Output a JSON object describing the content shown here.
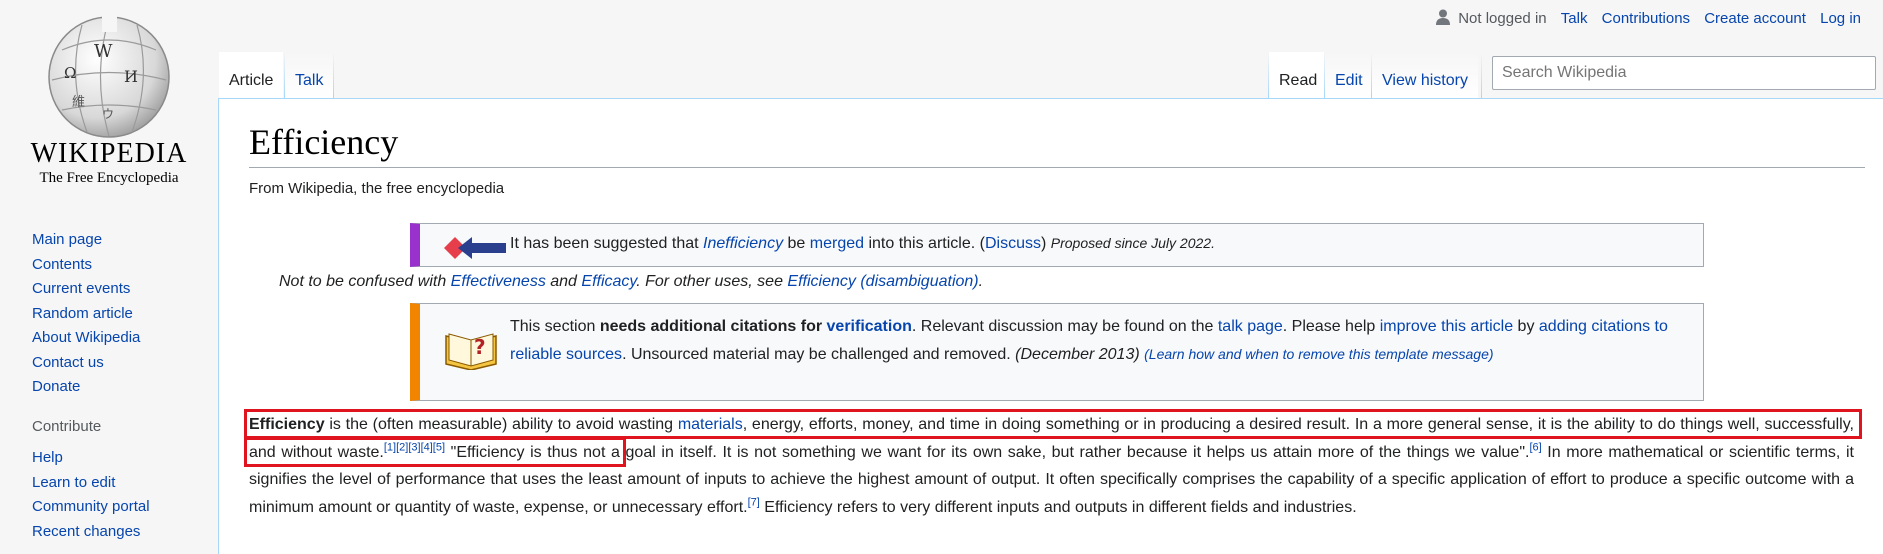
{
  "logo": {
    "wordmark": "WIKIPEDIA",
    "tagline": "The Free Encyclopedia"
  },
  "sidebar": {
    "nav": [
      "Main page",
      "Contents",
      "Current events",
      "Random article",
      "About Wikipedia",
      "Contact us",
      "Donate"
    ],
    "contribute_heading": "Contribute",
    "contribute": [
      "Help",
      "Learn to edit",
      "Community portal",
      "Recent changes"
    ]
  },
  "personal": {
    "status": "Not logged in",
    "talk": "Talk",
    "contributions": "Contributions",
    "create_account": "Create account",
    "login": "Log in"
  },
  "tabs": {
    "article": "Article",
    "talk": "Talk",
    "read": "Read",
    "edit": "Edit",
    "history": "View history"
  },
  "search": {
    "placeholder": "Search Wikipedia"
  },
  "page": {
    "title": "Efficiency",
    "tagline": "From Wikipedia, the free encyclopedia",
    "merge": {
      "pre": "It has been suggested that ",
      "target": "Inefficiency",
      "mid": " be ",
      "merged": "merged",
      "post": " into this article. (",
      "discuss": "Discuss",
      "close": ")",
      "since": "Proposed since July 2022."
    },
    "hatnote": {
      "pre": "Not to be confused with ",
      "l1": "Effectiveness",
      "and": " and ",
      "l2": "Efficacy",
      "mid": ". For other uses, see ",
      "l3": "Efficiency (disambiguation)",
      "end": "."
    },
    "cite": {
      "pre": "This section ",
      "bold": "needs additional citations for ",
      "verification": "verification",
      "t1": ". Relevant discussion may be found on the ",
      "talk_page": "talk page",
      "t2": ". Please help ",
      "improve": "improve this article",
      "t3": " by ",
      "adding": "adding citations to reliable sources",
      "t4": ". Unsourced material may be challenged and removed. ",
      "date": "(December 2013)",
      "learn": "(Learn how and when to remove this template message)"
    },
    "paragraph": {
      "term": "Efficiency",
      "t1": " is the (often measurable) ability to avoid wasting ",
      "materials": "materials",
      "t2": ", energy, efforts, money, and time in doing something or in producing a desired result. In a more general sense, it is the ability to do things well, successfully, and without waste.",
      "refs1": "[1][2][3][4][5]",
      "t3": " \"Efficiency is thus not a goal in itself. It is not something we want for its own sake, but rather because it helps us attain more of the things we value\".",
      "ref6": "[6]",
      "t4": " In more mathematical or scientific terms, it signifies the level of performance that uses the least amount of inputs to achieve the highest amount of output. It often specifically comprises the capability of a specific application of effort to produce a specific outcome with a minimum amount or quantity of waste, expense, or unnecessary effort.",
      "ref7": "[7]",
      "t5": " Efficiency refers to very different inputs and outputs in different fields and industries."
    }
  },
  "colors": {
    "link": "#0645ad",
    "highlight": "#e0141e",
    "merge_bar": "#9932cc",
    "cite_bar": "#f28500"
  }
}
